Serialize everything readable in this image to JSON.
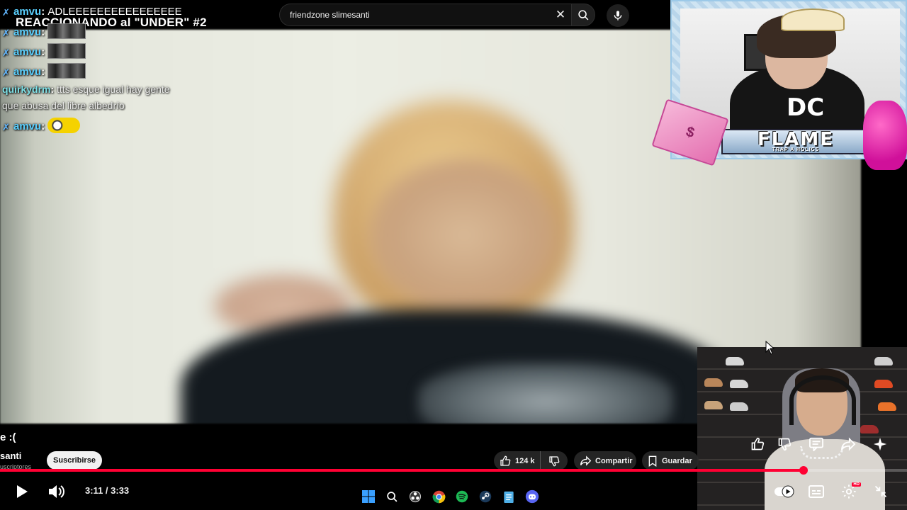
{
  "search": {
    "query": "friendzone slimesanti"
  },
  "stream": {
    "title": "REACCIONANDO al \"UNDER\" #2"
  },
  "chat": [
    {
      "user": "amvu",
      "message": "ADLEEEEEEEEEEEEEEEE",
      "emote": false
    },
    {
      "user": "amvu",
      "message": "",
      "emote": true
    },
    {
      "user": "amvu",
      "message": "",
      "emote": true
    },
    {
      "user": "amvu",
      "message": "",
      "emote": true
    },
    {
      "user": "quirkydrm",
      "message": "ttts esque igual hay gente",
      "message2": "que abusa del libre albedrío",
      "emote": false
    },
    {
      "user": "amvu",
      "message": "",
      "emote": true
    }
  ],
  "overlay": {
    "flame": "FLAME",
    "flame_sub": "TRAP A HOLICS"
  },
  "video": {
    "title_fragment": "e :(",
    "channel_fragment": "santi",
    "subs_fragment": "uscriptores",
    "subscribe_label": "Suscribirse",
    "likes": "124 k",
    "share_label": "Compartir",
    "save_label": "Guardar",
    "progress_fraction": 0.886
  },
  "player": {
    "time": "3:11 / 3:33"
  },
  "colors": {
    "accent": "#ff0033",
    "chat_user": "#5ad0ff"
  }
}
